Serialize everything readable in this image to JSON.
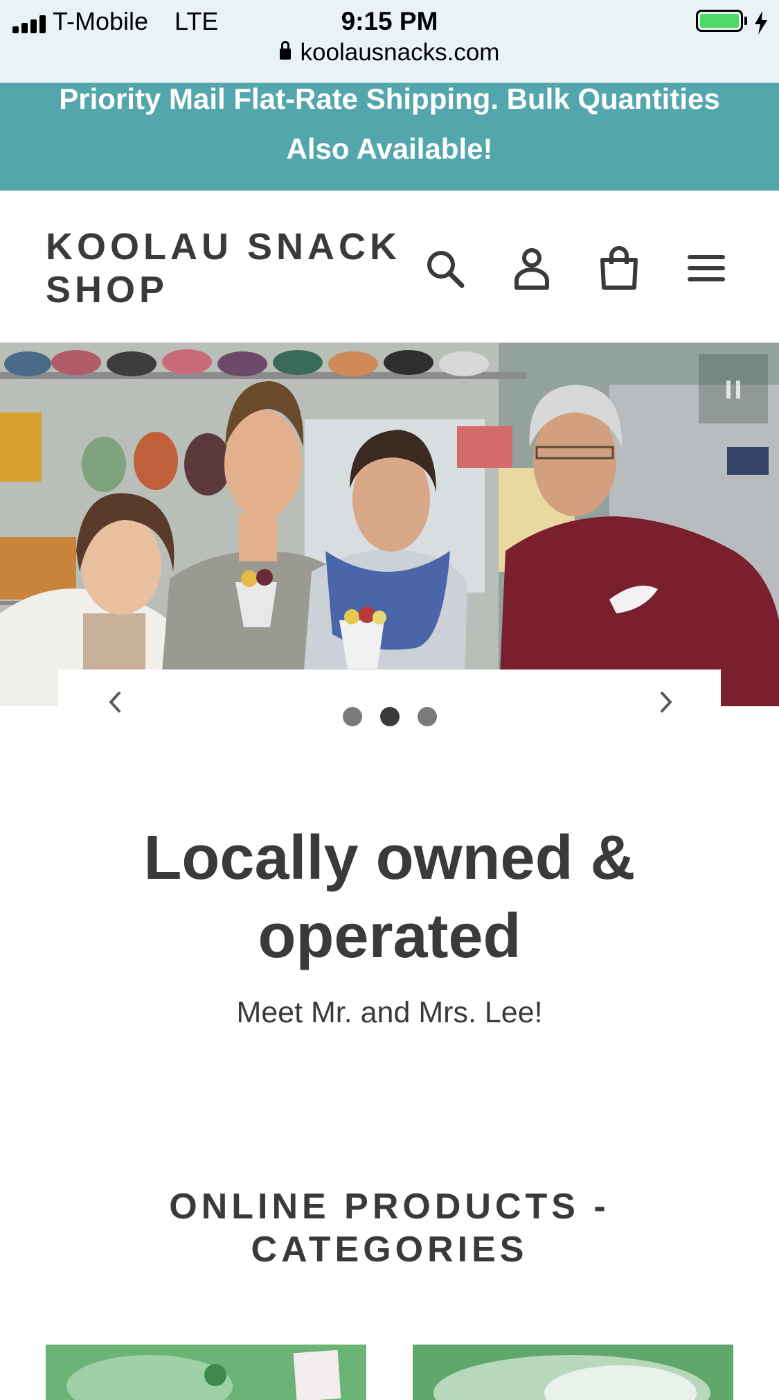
{
  "status_bar": {
    "carrier": "T-Mobile",
    "network": "LTE",
    "time": "9:15 PM",
    "battery_level": 1.0,
    "url": "koolausnacks.com"
  },
  "announcement": {
    "text": "Priority Mail Flat-Rate Shipping. Bulk Quantities Also Available!",
    "background": "#54a6ad"
  },
  "header": {
    "logo": "KOOLAU SNACK SHOP",
    "icons": [
      "search-icon",
      "account-icon",
      "cart-icon",
      "menu-icon"
    ]
  },
  "slideshow": {
    "total_slides": 3,
    "active_slide": 2,
    "controls": [
      "previous-arrow-icon",
      "next-arrow-icon",
      "pause-icon"
    ]
  },
  "hero": {
    "heading": "Locally owned & operated",
    "subheading": "Meet Mr. and Mrs. Lee!"
  },
  "collection": {
    "title": "ONLINE PRODUCTS - CATEGORIES"
  },
  "colors": {
    "accent": "#54a6ad",
    "text": "#3a3a3a"
  }
}
